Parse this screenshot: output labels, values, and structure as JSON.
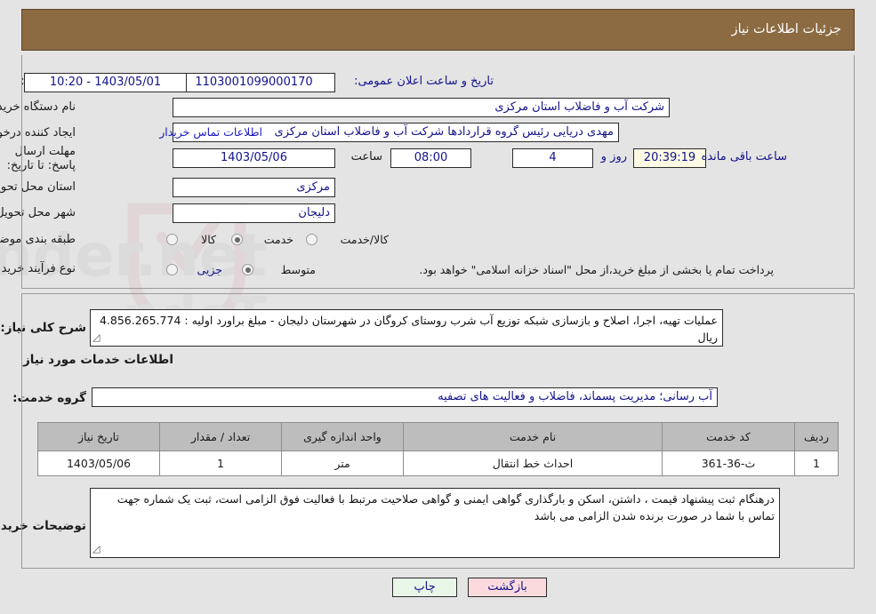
{
  "header": {
    "title": "جزئیات اطلاعات نیاز"
  },
  "form": {
    "need_number_label": "شماره نیاز:",
    "need_number_value": "1103001099000170",
    "announce_datetime_label": "تاریخ و ساعت اعلان عمومی:",
    "announce_datetime_value": "1403/05/01 - 10:20",
    "buyer_org_label": "نام دستگاه خریدار:",
    "buyer_org_value": "شرکت آب و فاضلاب استان مرکزی",
    "creator_label": "ایجاد کننده درخواست:",
    "creator_value": "مهدی دریایی رئیس گروه قراردادها شرکت آب و فاضلاب استان مرکزی",
    "contact_link": "اطلاعات تماس خریدار",
    "deadline_label": "مهلت ارسال پاسخ: تا تاریخ:",
    "deadline_date": "1403/05/06",
    "hour_label": "ساعت",
    "hour_value": "08:00",
    "days_value": "4",
    "days_label": "روز و",
    "timer_value": "20:39:19",
    "remaining_label": "ساعت باقی مانده",
    "province_label": "استان محل تحویل:",
    "province_value": "مرکزی",
    "city_label": "شهر محل تحویل:",
    "city_value": "دلیجان",
    "category_label": "طبقه بندی موضوعی:",
    "category_options": [
      "کالا",
      "خدمت",
      "کالا/خدمت"
    ],
    "category_selected": "خدمت",
    "process_label": "نوع فرآیند خرید :",
    "process_options": [
      "جزیی",
      "متوسط"
    ],
    "process_selected": "متوسط",
    "payment_note": "پرداخت تمام یا بخشی از مبلغ خرید،از محل \"اسناد خزانه اسلامی\" خواهد بود."
  },
  "description": {
    "general_label": "شرح کلی نیاز:",
    "general_value": "عملیات تهیه، اجرا، اصلاح و بازسازی  شبکه توزیع آب شرب روستای کروگان در شهرستان دلیجان - مبلغ براورد اولیه : 4.856.265.774 ریال",
    "services_heading": "اطلاعات خدمات مورد نیاز",
    "service_group_label": "گروه خدمت:",
    "service_group_value": "آب رسانی؛ مدیریت پسماند، فاضلاب و فعالیت های تصفیه"
  },
  "table": {
    "headers": [
      "ردیف",
      "کد خدمت",
      "نام خدمت",
      "واحد اندازه گیری",
      "تعداد / مقدار",
      "تاریخ نیاز"
    ],
    "rows": [
      {
        "row": "1",
        "code": "ث-36-361",
        "name": "احداث خط انتقال",
        "unit": "متر",
        "qty": "1",
        "date": "1403/05/06"
      }
    ]
  },
  "buyer_notes": {
    "label": "توضیحات خریدار:",
    "value": "درهنگام ثبت پیشنهاد قیمت ، داشتن، اسکن و بارگذاری گواهی ایمنی و گواهی صلاحیت مرتبط با فعالیت فوق الزامی است، ثبت یک شماره جهت تماس با شما در صورت برنده شدن الزامی می باشد"
  },
  "footer": {
    "print_label": "چاپ",
    "back_label": "بازگشت"
  },
  "watermark": {
    "text": "AriaTender.net"
  }
}
